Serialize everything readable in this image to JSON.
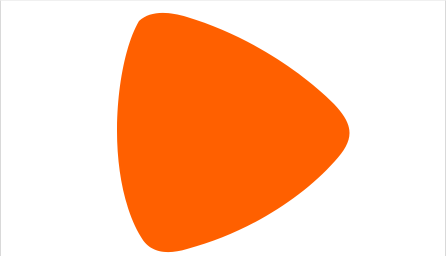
{
  "logo": {
    "icon": "zalando-logo-icon",
    "color": "#FF6000"
  }
}
